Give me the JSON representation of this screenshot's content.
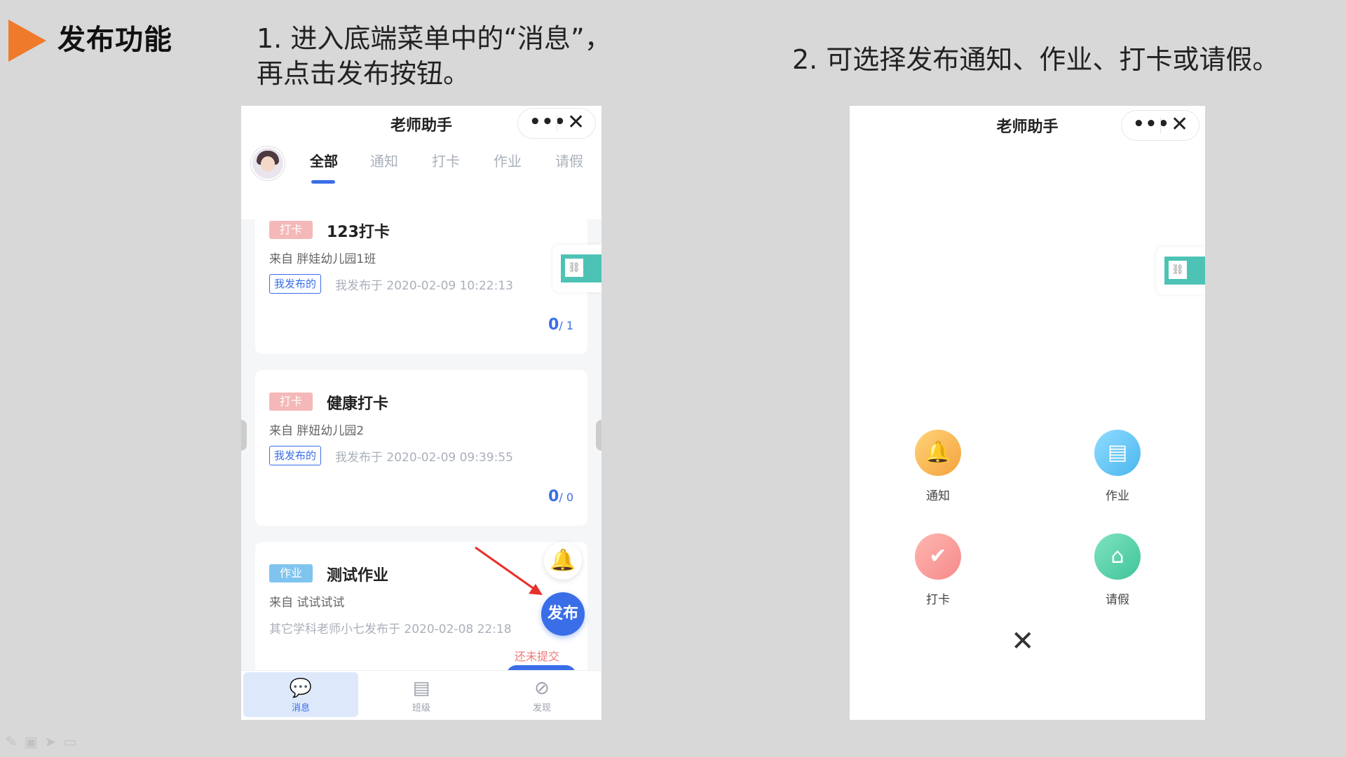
{
  "heading": {
    "title": "发布功能",
    "step1": "1. 进入底端菜单中的“消息”，再点击发布按钮。",
    "step2": "2. 可选择发布通知、作业、打卡或请假。"
  },
  "phone1": {
    "app_title": "老师助手",
    "more_icon": "•••",
    "close_icon": "✕",
    "tabs": [
      "全部",
      "通知",
      "打卡",
      "作业",
      "请假"
    ],
    "cards": [
      {
        "tag": "打卡",
        "title": "123打卡",
        "from": "来自 胖娃幼儿园1班",
        "mine": "我发布的",
        "time": "我发布于 2020-02-09 10:22:13",
        "done": "0",
        "total": "/ 1"
      },
      {
        "tag": "打卡",
        "title": "健康打卡",
        "from": "来自 胖妞幼儿园2",
        "mine": "我发布的",
        "time": "我发布于 2020-02-09 09:39:55",
        "done": "0",
        "total": "/ 0"
      },
      {
        "tag": "作业",
        "title": "测试作业",
        "from": "来自 试试试试",
        "time": "其它学科老师小七发布于 2020-02-08 22:18",
        "status": "还未提交"
      }
    ],
    "publish_label": "发布",
    "bottom_nav": [
      "消息",
      "班级",
      "发现"
    ]
  },
  "phone2": {
    "app_title": "老师助手",
    "more_icon": "•••",
    "close_icon": "✕",
    "menu": [
      "通知",
      "作业",
      "打卡",
      "请假"
    ],
    "menu_close": "✕"
  },
  "colors": {
    "accent_blue": "#3a6ee8",
    "arrow_orange": "#f07a2c",
    "punch_tag": "#f5b8b8",
    "homework_tag": "#7fc4ef"
  }
}
